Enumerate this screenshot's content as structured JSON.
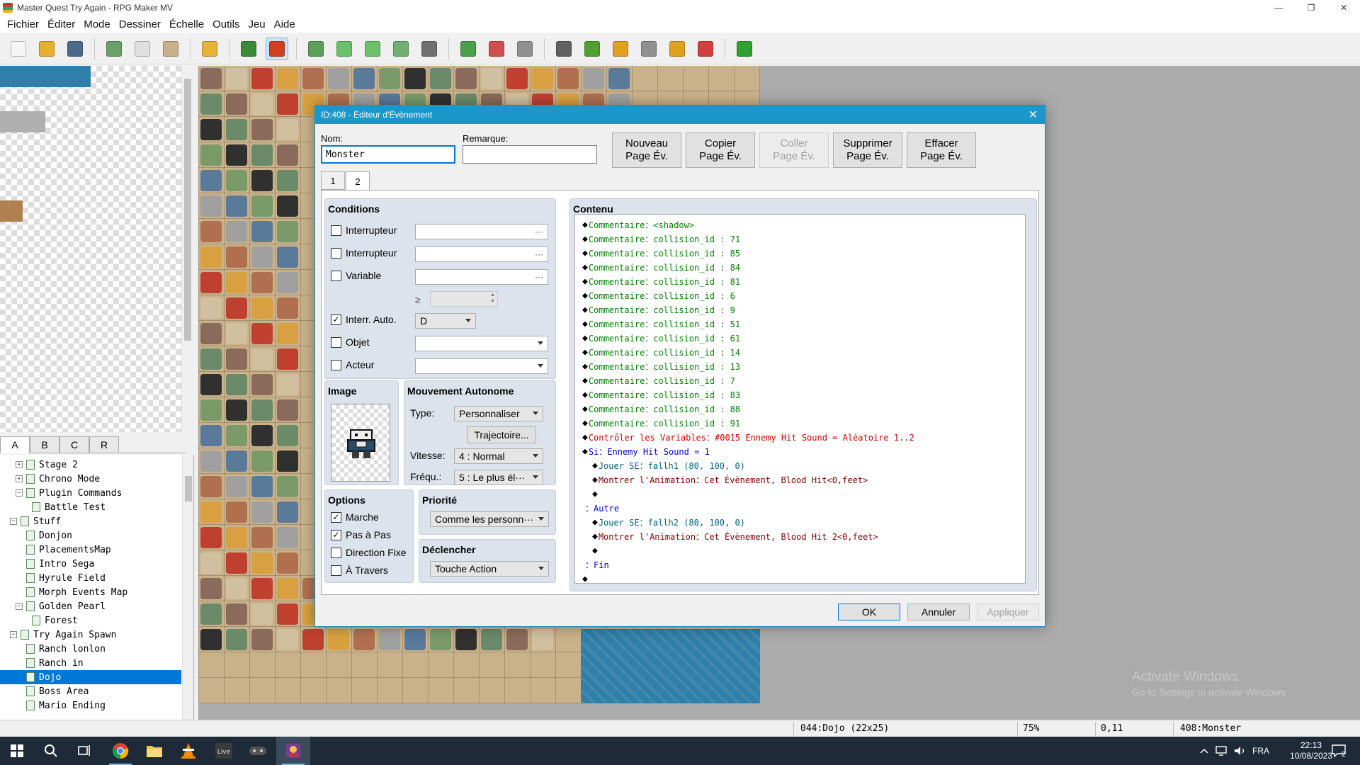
{
  "window": {
    "title": "Master Quest Try Again - RPG Maker MV",
    "minimize": "—",
    "maximize": "❐",
    "close": "✕"
  },
  "menu": [
    "Fichier",
    "Éditer",
    "Mode",
    "Dessiner",
    "Échelle",
    "Outils",
    "Jeu",
    "Aide"
  ],
  "toolbar": [
    {
      "name": "new-project-icon",
      "color": "#f5f5f5"
    },
    {
      "name": "open-project-icon",
      "color": "#e8b030"
    },
    {
      "name": "save-project-icon",
      "color": "#4a6a8a"
    },
    {
      "name": "sep"
    },
    {
      "name": "cut-icon",
      "color": "#6aa06a"
    },
    {
      "name": "copy-icon",
      "color": "#e0e0e0"
    },
    {
      "name": "paste-icon",
      "color": "#c8b08a"
    },
    {
      "name": "sep"
    },
    {
      "name": "undo-icon",
      "color": "#e6b23a"
    },
    {
      "name": "sep"
    },
    {
      "name": "map-mode-icon",
      "color": "#3a8a3a"
    },
    {
      "name": "event-mode-icon",
      "color": "#d04020",
      "active": true
    },
    {
      "name": "sep"
    },
    {
      "name": "pencil-icon",
      "color": "#5aa05a"
    },
    {
      "name": "rectangle-icon",
      "color": "#6cc06c"
    },
    {
      "name": "ellipse-icon",
      "color": "#6cc06c"
    },
    {
      "name": "fill-icon",
      "color": "#70b070"
    },
    {
      "name": "shadow-pen-icon",
      "color": "#707070"
    },
    {
      "name": "sep"
    },
    {
      "name": "zoom-in-icon",
      "color": "#4aa04a"
    },
    {
      "name": "zoom-out-icon",
      "color": "#d05050"
    },
    {
      "name": "zoom-actual-icon",
      "color": "#909090"
    },
    {
      "name": "sep"
    },
    {
      "name": "database-icon",
      "color": "#606060"
    },
    {
      "name": "plugin-manager-icon",
      "color": "#50a030"
    },
    {
      "name": "sound-test-icon",
      "color": "#e0a020"
    },
    {
      "name": "event-searcher-icon",
      "color": "#909090"
    },
    {
      "name": "resource-manager-icon",
      "color": "#e0a020"
    },
    {
      "name": "character-generator-icon",
      "color": "#d04040"
    },
    {
      "name": "sep"
    },
    {
      "name": "playtest-icon",
      "color": "#30a030"
    }
  ],
  "tile_tabs": [
    "A",
    "B",
    "C",
    "R"
  ],
  "map_tree": [
    {
      "label": "Stage 2",
      "indent": 1,
      "exp": "+"
    },
    {
      "label": "Chrono Mode",
      "indent": 1,
      "exp": "+"
    },
    {
      "label": "Plugin Commands",
      "indent": 1,
      "exp": "−"
    },
    {
      "label": "Battle Test",
      "indent": 2
    },
    {
      "label": "Stuff",
      "indent": 0,
      "exp": "−"
    },
    {
      "label": "Donjon",
      "indent": 1
    },
    {
      "label": "PlacementsMap",
      "indent": 1
    },
    {
      "label": "Intro Sega",
      "indent": 1
    },
    {
      "label": "Hyrule Field",
      "indent": 1
    },
    {
      "label": "Morph Events Map",
      "indent": 1
    },
    {
      "label": "Golden Pearl",
      "indent": 1,
      "exp": "−"
    },
    {
      "label": "Forest",
      "indent": 2
    },
    {
      "label": "Try Again Spawn",
      "indent": 0,
      "exp": "−"
    },
    {
      "label": "Ranch lonlon",
      "indent": 1
    },
    {
      "label": "Ranch in",
      "indent": 1
    },
    {
      "label": "Dojo",
      "indent": 1,
      "selected": true
    },
    {
      "label": "Boss Area",
      "indent": 1
    },
    {
      "label": "Mario Ending",
      "indent": 1
    }
  ],
  "status": {
    "map": "044:Dojo (22x25)",
    "zoom": "75%",
    "coords": "0,11",
    "event": "408:Monster"
  },
  "watermark": {
    "line1": "Activate Windows",
    "line2": "Go to Settings to activate Windows"
  },
  "taskbar": {
    "apps": [
      "windows-start-icon",
      "search-icon",
      "task-view-icon",
      "chrome-icon",
      "file-explorer-icon",
      "vlc-icon",
      "live-app-icon",
      "game-controller-icon",
      "rpg-maker-icon"
    ],
    "lang": "FRA",
    "time": "22:13",
    "date": "10/08/2023",
    "notifications": "2"
  },
  "dialog": {
    "title": "ID:408 - Éditeur d'Évènement",
    "name_label": "Nom:",
    "name_value": "Monster",
    "note_label": "Remarque:",
    "note_value": "",
    "page_buttons": [
      {
        "l1": "Nouveau",
        "l2": "Page Év.",
        "disabled": false
      },
      {
        "l1": "Copier",
        "l2": "Page Év.",
        "disabled": false
      },
      {
        "l1": "Coller",
        "l2": "Page Év.",
        "disabled": true
      },
      {
        "l1": "Supprimer",
        "l2": "Page Év.",
        "disabled": false
      },
      {
        "l1": "Effacer",
        "l2": "Page Év.",
        "disabled": false
      }
    ],
    "tabs": [
      "1",
      "2"
    ],
    "selected_tab": "2",
    "conditions": {
      "title": "Conditions",
      "switch1": {
        "label": "Interrupteur",
        "checked": false,
        "value": "···"
      },
      "switch2": {
        "label": "Interrupteur",
        "checked": false,
        "value": "···"
      },
      "variable": {
        "label": "Variable",
        "checked": false,
        "value": "···"
      },
      "ge": "≥",
      "self_switch": {
        "label": "Interr. Auto.",
        "checked": true,
        "value": "D"
      },
      "item": {
        "label": "Objet",
        "checked": false
      },
      "actor": {
        "label": "Acteur",
        "checked": false
      }
    },
    "image": {
      "title": "Image"
    },
    "movement": {
      "title": "Mouvement Autonome",
      "type_label": "Type:",
      "type_value": "Personnaliser",
      "route_button": "Trajectoire...",
      "speed_label": "Vitesse:",
      "speed_value": "4 : Normal",
      "freq_label": "Fréqu.:",
      "freq_value": "5 : Le plus él···"
    },
    "options": {
      "title": "Options",
      "walking": {
        "label": "Marche",
        "checked": true
      },
      "stepping": {
        "label": "Pas à Pas",
        "checked": true
      },
      "direction_fix": {
        "label": "Direction Fixe",
        "checked": false
      },
      "through": {
        "label": "À Travers",
        "checked": false
      }
    },
    "priority": {
      "title": "Priorité",
      "value": "Comme les personn···"
    },
    "trigger": {
      "title": "Déclencher",
      "value": "Touche Action"
    },
    "content": {
      "title": "Contenu",
      "lines": [
        {
          "indent": 0,
          "diamond": true,
          "cls": "c-comment",
          "text": "Commentaire：<shadow>"
        },
        {
          "indent": 0,
          "diamond": true,
          "cls": "c-comment",
          "text": "Commentaire：collision_id : 71"
        },
        {
          "indent": 0,
          "diamond": true,
          "cls": "c-comment",
          "text": "Commentaire：collision_id : 85"
        },
        {
          "indent": 0,
          "diamond": true,
          "cls": "c-comment",
          "text": "Commentaire：collision_id : 84"
        },
        {
          "indent": 0,
          "diamond": true,
          "cls": "c-comment",
          "text": "Commentaire：collision_id : 81"
        },
        {
          "indent": 0,
          "diamond": true,
          "cls": "c-comment",
          "text": "Commentaire：collision_id : 6"
        },
        {
          "indent": 0,
          "diamond": true,
          "cls": "c-comment",
          "text": "Commentaire：collision_id : 9"
        },
        {
          "indent": 0,
          "diamond": true,
          "cls": "c-comment",
          "text": "Commentaire：collision_id : 51"
        },
        {
          "indent": 0,
          "diamond": true,
          "cls": "c-comment",
          "text": "Commentaire：collision_id : 61"
        },
        {
          "indent": 0,
          "diamond": true,
          "cls": "c-comment",
          "text": "Commentaire：collision_id : 14"
        },
        {
          "indent": 0,
          "diamond": true,
          "cls": "c-comment",
          "text": "Commentaire：collision_id : 13"
        },
        {
          "indent": 0,
          "diamond": true,
          "cls": "c-comment",
          "text": "Commentaire：collision_id : 7"
        },
        {
          "indent": 0,
          "diamond": true,
          "cls": "c-comment",
          "text": "Commentaire：collision_id : 83"
        },
        {
          "indent": 0,
          "diamond": true,
          "cls": "c-comment",
          "text": "Commentaire：collision_id : 88"
        },
        {
          "indent": 0,
          "diamond": true,
          "cls": "c-comment",
          "text": "Commentaire：collision_id : 91"
        },
        {
          "indent": 0,
          "diamond": true,
          "cls": "c-var",
          "text": "Contrôler les Variables：#0015 Ennemy Hit Sound = Aléatoire 1..2"
        },
        {
          "indent": 0,
          "diamond": true,
          "cls": "c-if",
          "text": "Si：Ennemy Hit Sound = 1"
        },
        {
          "indent": 1,
          "diamond": true,
          "cls": "c-se",
          "text": "Jouer SE：fallh1 (80, 100, 0)"
        },
        {
          "indent": 1,
          "diamond": true,
          "cls": "c-anim",
          "text": "Montrer l'Animation：Cet Évènement, Blood Hit<0,feet>"
        },
        {
          "indent": 1,
          "diamond": true,
          "cls": "",
          "text": ""
        },
        {
          "indent": 0,
          "diamond": false,
          "cls": "c-if",
          "text": "：Autre"
        },
        {
          "indent": 1,
          "diamond": true,
          "cls": "c-se",
          "text": "Jouer SE：fallh2 (80, 100, 0)"
        },
        {
          "indent": 1,
          "diamond": true,
          "cls": "c-anim",
          "text": "Montrer l'Animation：Cet Évènement, Blood Hit 2<0,feet>"
        },
        {
          "indent": 1,
          "diamond": true,
          "cls": "",
          "text": ""
        },
        {
          "indent": 0,
          "diamond": false,
          "cls": "c-if",
          "text": "：Fin"
        },
        {
          "indent": 0,
          "diamond": true,
          "cls": "",
          "text": ""
        }
      ]
    },
    "ok": "OK",
    "cancel": "Annuler",
    "apply": "Appliquer"
  }
}
